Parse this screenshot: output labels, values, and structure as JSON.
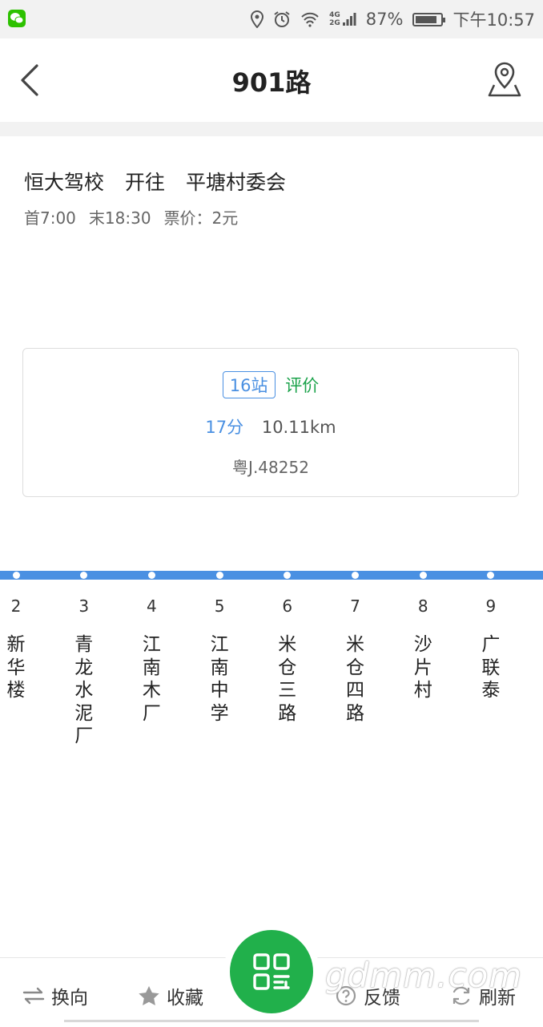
{
  "status_bar": {
    "battery_percent": "87%",
    "battery_level": 0.87,
    "network_badge_top": "4G",
    "network_badge_bottom": "2G",
    "time": "下午10:57"
  },
  "header": {
    "title": "901路"
  },
  "route": {
    "origin": "恒大驾校",
    "direction_word": "开往",
    "destination": "平塘村委会",
    "first_bus": "首7:00",
    "last_bus": "末18:30",
    "fare": "票价：2元"
  },
  "card": {
    "stops_count": "16站",
    "rate_label": "评价",
    "duration": "17分",
    "distance": "10.11km",
    "plate": "粤J.48252"
  },
  "stops": [
    {
      "num": "2",
      "name": "新华楼"
    },
    {
      "num": "3",
      "name": "青龙水泥厂"
    },
    {
      "num": "4",
      "name": "江南木厂"
    },
    {
      "num": "5",
      "name": "江南中学"
    },
    {
      "num": "6",
      "name": "米仓三路"
    },
    {
      "num": "7",
      "name": "米仓四路"
    },
    {
      "num": "8",
      "name": "沙片村"
    },
    {
      "num": "9",
      "name": "广联泰"
    }
  ],
  "bottom_nav": {
    "reverse": "换向",
    "favorite": "收藏",
    "feedback": "反馈",
    "refresh": "刷新"
  },
  "watermark": "gdmm.com",
  "colors": {
    "accent_blue": "#4a90e2",
    "green": "#21b04b",
    "rate_green": "#1aa24a"
  }
}
